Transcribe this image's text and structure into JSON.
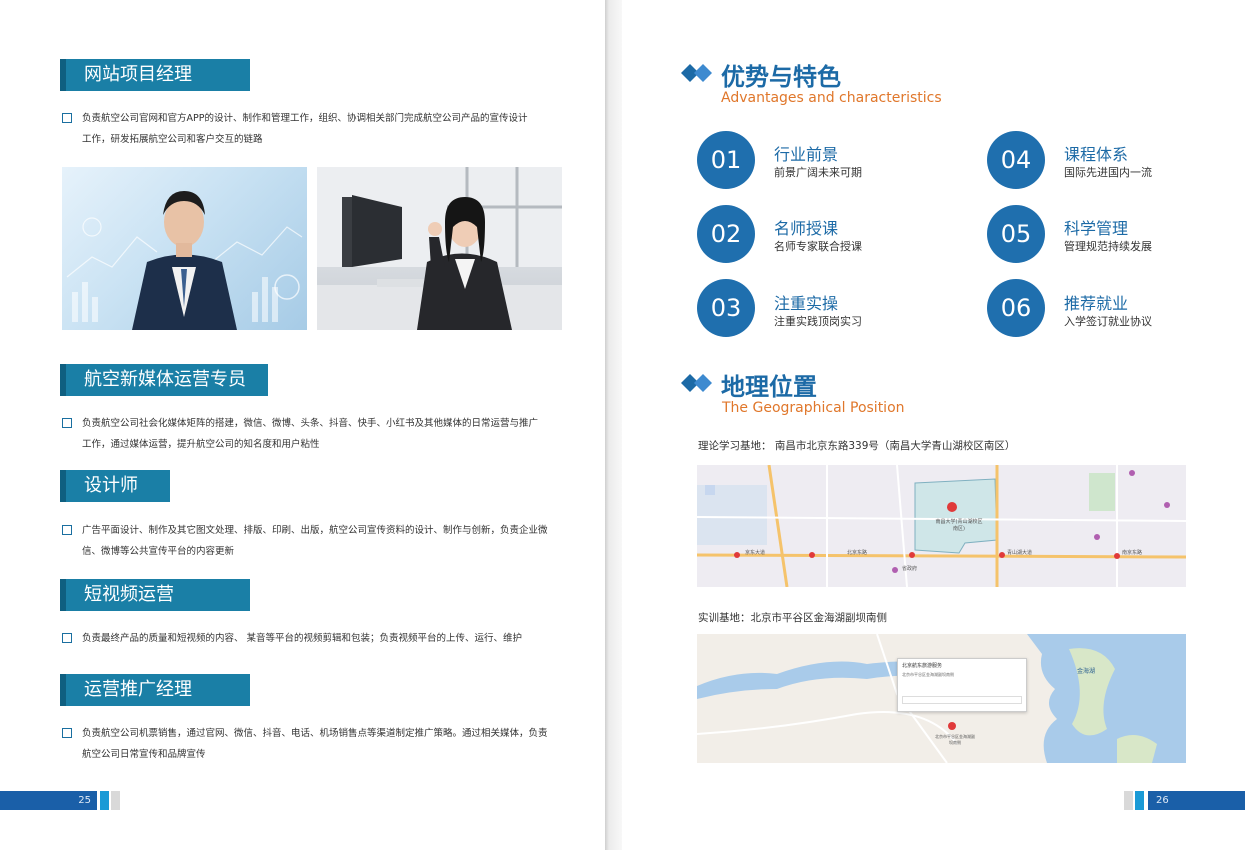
{
  "left_page": {
    "jobs": [
      {
        "title": "网站项目经理",
        "lines": [
          "负责航空公司官网和官方APP的设计、制作和管理工作，组织、协调相关部门完成航空公司产品的宣传设计",
          "工作，研发拓展航空公司和客户交互的链路"
        ]
      },
      {
        "title": "航空新媒体运营专员",
        "lines": [
          "负责航空公司社会化媒体矩阵的搭建，微信、微博、头条、抖音、快手、小红书及其他媒体的日常运营与推广",
          "工作，通过媒体运营，提升航空公司的知名度和用户粘性"
        ]
      },
      {
        "title": "设计师",
        "lines": [
          "广告平面设计、制作及其它图文处理、排版、印刷、出版，航空公司宣传资料的设计、制作与创新，负责企业微",
          "信、微博等公共宣传平台的内容更新"
        ]
      },
      {
        "title": "短视频运营",
        "lines": [
          "负责最终产品的质量和短视频的内容、 某音等平台的视频剪辑和包装；负责视频平台的上传、运行、维护"
        ]
      },
      {
        "title": "运营推广经理",
        "lines": [
          "负责航空公司机票销售，通过官网、微信、抖音、电话、机场销售点等渠道制定推广策略。通过相关媒体，负责",
          "航空公司日常宣传和品牌宣传"
        ]
      }
    ],
    "page_number": "25"
  },
  "right_page": {
    "advantages": {
      "title": "优势与特色",
      "subtitle": "Advantages and characteristics",
      "items": [
        {
          "num": "01",
          "title": "行业前景",
          "desc": "前景广阔未来可期"
        },
        {
          "num": "02",
          "title": "名师授课",
          "desc": "名师专家联合授课"
        },
        {
          "num": "03",
          "title": "注重实操",
          "desc": "注重实践顶岗实习"
        },
        {
          "num": "04",
          "title": "课程体系",
          "desc": "国际先进国内一流"
        },
        {
          "num": "05",
          "title": "科学管理",
          "desc": "管理规范持续发展"
        },
        {
          "num": "06",
          "title": "推荐就业",
          "desc": "入学签订就业协议"
        }
      ]
    },
    "location": {
      "title": "地理位置",
      "subtitle": "The Geographical Position",
      "theory_address": "理论学习基地： 南昌市北京东路339号（南昌大学青山湖校区南区）",
      "training_address": "实训基地：北京市平谷区金海湖副坝南侧",
      "map1_labels": [
        "南昌大学(青山湖校区南区)",
        "北京东路",
        "青山湖大道",
        "南京东路",
        "省政府",
        "京东大道"
      ],
      "map2_labels": [
        "北京航东旅游服务",
        "金海湖",
        "北京市平谷区金海湖副坝南侧",
        "北京市平谷区金海湖副坝南侧"
      ]
    },
    "page_number": "26"
  },
  "colors": {
    "accent": "#1a7fa6",
    "heading": "#1c6aa6",
    "subtitle": "#e0772b",
    "footer": "#1a5fa8"
  }
}
